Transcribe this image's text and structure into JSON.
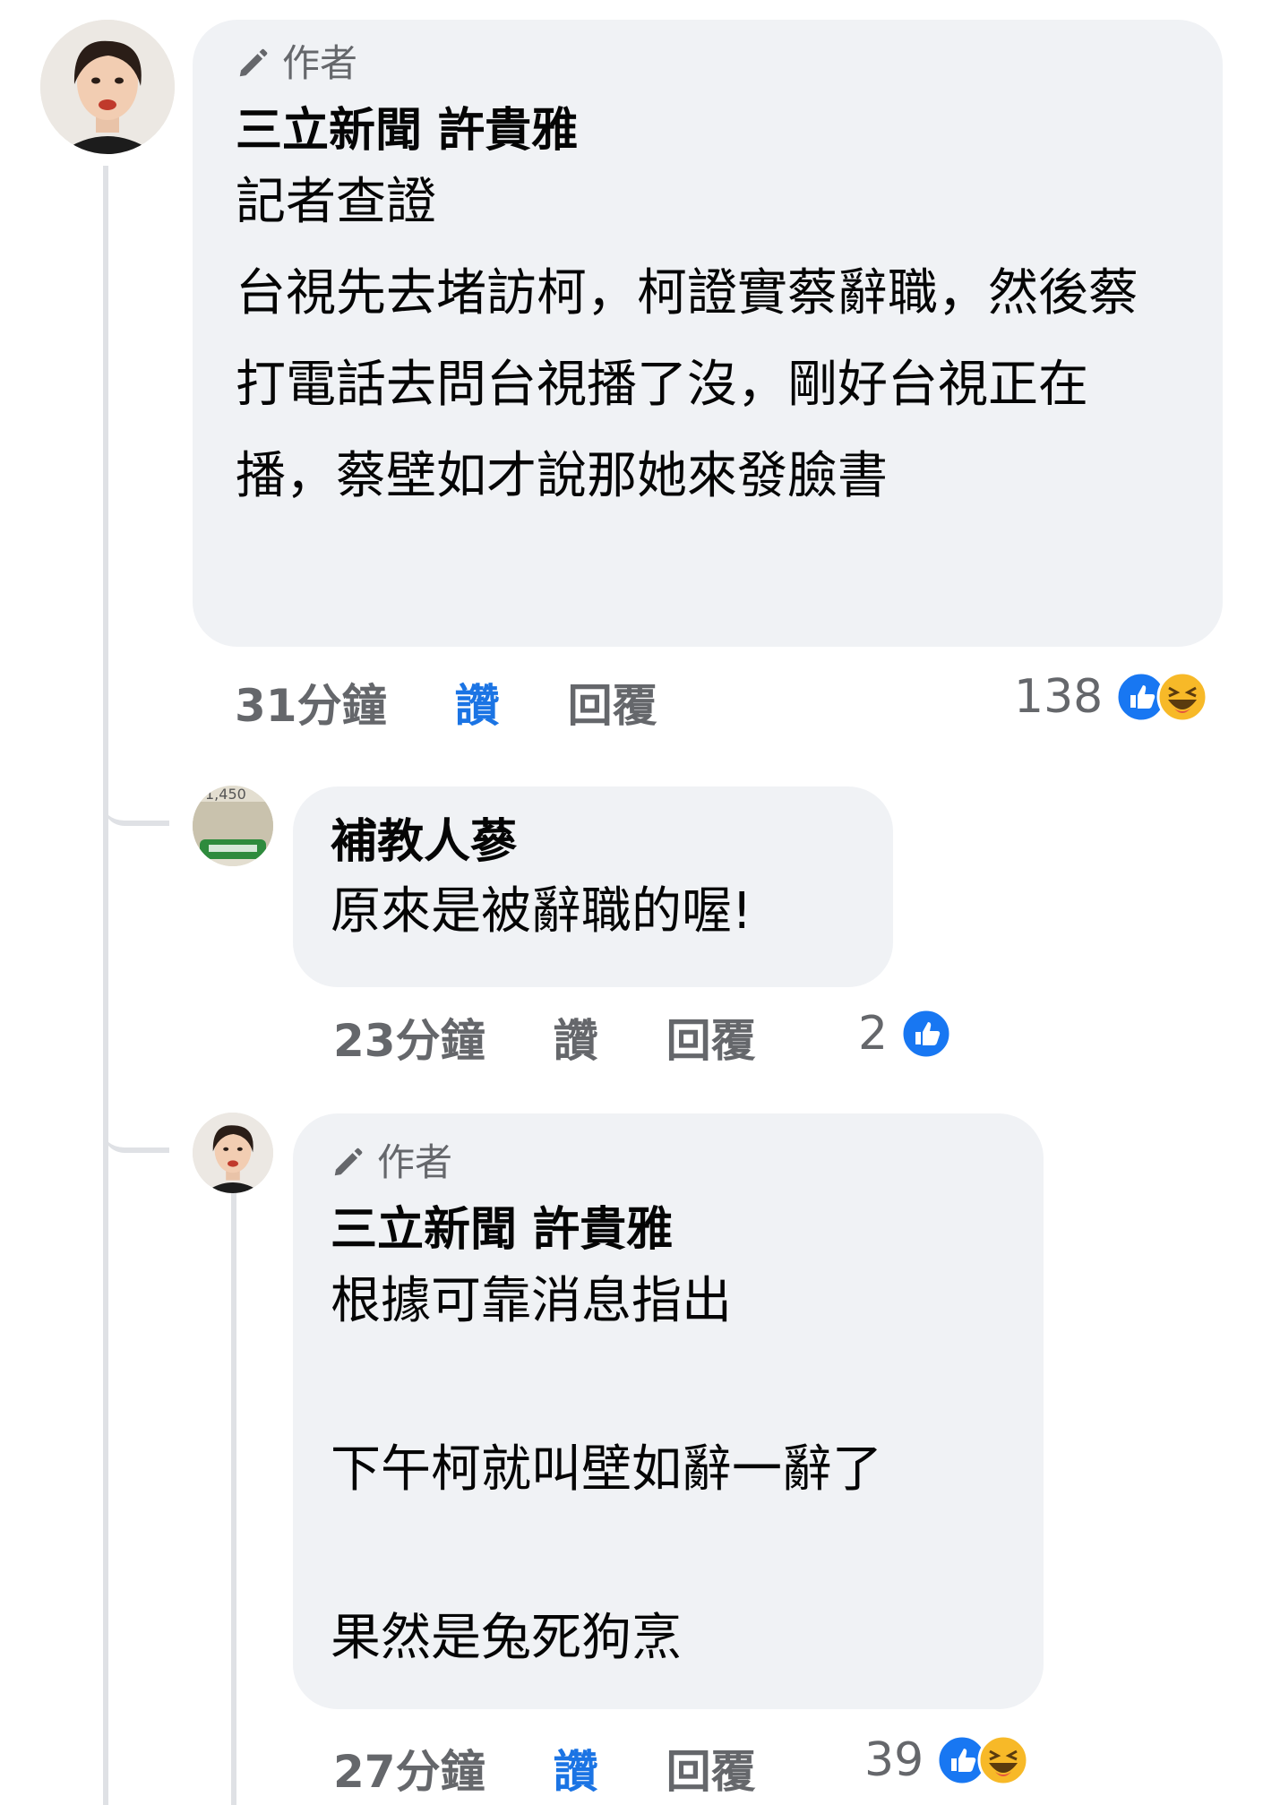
{
  "comments": [
    {
      "badge": "作者",
      "author": "三立新聞 許貴雅",
      "text": "記者查證\n台視先去堵訪柯，柯證實蔡辭職，然後蔡打電話去問台視播了沒，剛好台視正在播，蔡壁如才說那她來發臉書",
      "time": "31分鐘",
      "like_label": "讚",
      "reply_label": "回覆",
      "reaction_count": "138",
      "reactions": [
        "like-icon",
        "haha-icon"
      ],
      "like_active": true
    }
  ],
  "replies": [
    {
      "author": "補教人蔘",
      "avatar_text": "1,450",
      "text": "原來是被辭職的喔!",
      "time": "23分鐘",
      "like_label": "讚",
      "reply_label": "回覆",
      "reaction_count": "2",
      "reactions": [
        "like-icon"
      ],
      "like_active": false
    },
    {
      "badge": "作者",
      "author": "三立新聞 許貴雅",
      "text": "根據可靠消息指出\n\n下午柯就叫壁如辭一辭了\n\n果然是兔死狗烹",
      "time": "27分鐘",
      "like_label": "讚",
      "reply_label": "回覆",
      "reaction_count": "39",
      "reactions": [
        "like-icon",
        "haha-icon"
      ],
      "like_active": true
    }
  ],
  "colors": {
    "bubble": "#f0f2f5",
    "meta_gray": "#65676b",
    "like_blue": "#1b74e4",
    "line": "#dfe1e5"
  }
}
